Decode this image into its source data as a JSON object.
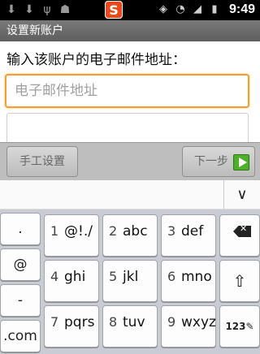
{
  "status_bar": {
    "left_icons": [
      "download-icon",
      "download-icon",
      "usb-icon",
      "android-icon"
    ],
    "sogou_label": "S",
    "right_icons": [
      "rotate-icon",
      "wifi-icon",
      "signal-icon",
      "battery-icon"
    ],
    "time": "9:49"
  },
  "title_bar": {
    "title": "设置新账户"
  },
  "form": {
    "prompt": "输入该账户的电子邮件地址：",
    "email_placeholder": "电子邮件地址",
    "email_value": ""
  },
  "actions": {
    "manual_setup_label": "手工设置",
    "next_label": "下一步"
  },
  "keyboard": {
    "collapse_icon": "chevron-down-icon",
    "left_column": [
      ".",
      "@",
      "-",
      ".com"
    ],
    "rows": [
      [
        {
          "num": "1",
          "letters": "@!./"
        },
        {
          "num": "2",
          "letters": "abc"
        },
        {
          "num": "3",
          "letters": "def"
        }
      ],
      [
        {
          "num": "4",
          "letters": "ghi"
        },
        {
          "num": "5",
          "letters": "jkl"
        },
        {
          "num": "6",
          "letters": "mno"
        }
      ],
      [
        {
          "num": "7",
          "letters": "pqrs"
        },
        {
          "num": "8",
          "letters": "tuv"
        },
        {
          "num": "9",
          "letters": "wxyz"
        }
      ]
    ],
    "right_column": {
      "backspace_icon": "backspace-icon",
      "shift_icon": "shift-icon",
      "mode_label": "123✎"
    }
  },
  "colors": {
    "focus_border": "#f2a02b",
    "next_icon": "#4fae2a",
    "sogou_brand": "#e8491d"
  }
}
